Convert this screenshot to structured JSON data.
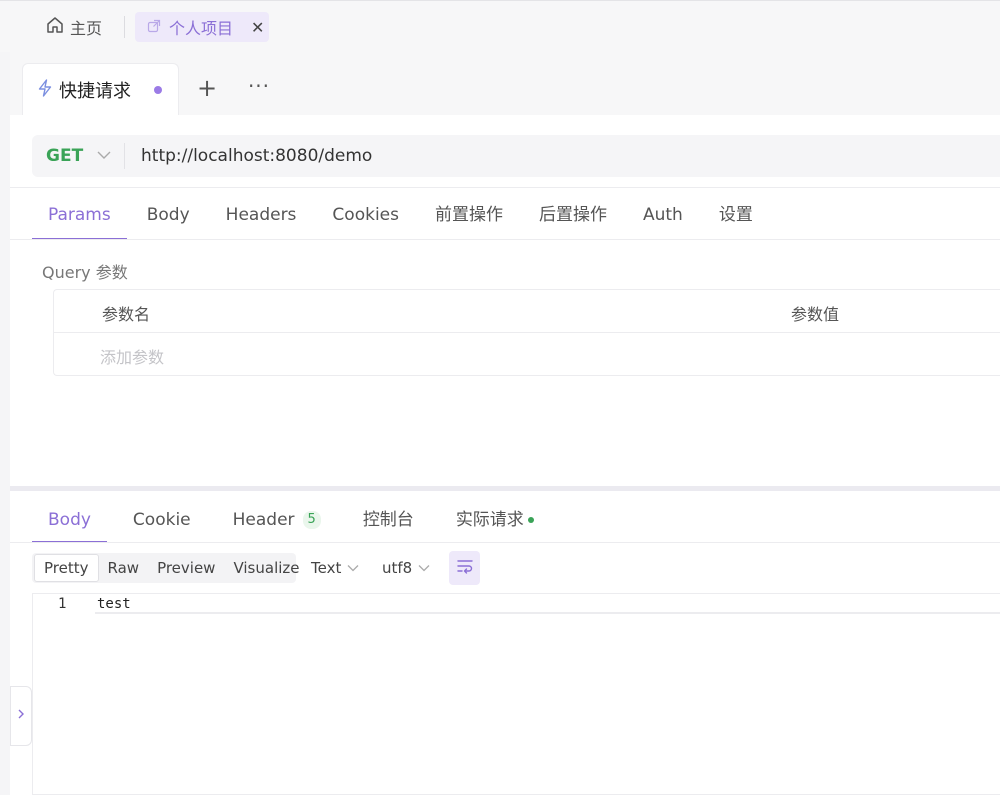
{
  "top_tabs": {
    "home_label": "主页",
    "project_label": "个人项目",
    "project_close": "✕"
  },
  "request_tab": {
    "label": "快捷请求",
    "add_label": "+",
    "more_label": "···"
  },
  "request": {
    "method": "GET",
    "url": "http://localhost:8080/demo"
  },
  "request_tabs": [
    {
      "label": "Params",
      "active": true
    },
    {
      "label": "Body"
    },
    {
      "label": "Headers"
    },
    {
      "label": "Cookies"
    },
    {
      "label": "前置操作"
    },
    {
      "label": "后置操作"
    },
    {
      "label": "Auth"
    },
    {
      "label": "设置"
    }
  ],
  "params": {
    "section_label": "Query 参数",
    "col_name": "参数名",
    "col_value": "参数值",
    "add_placeholder": "添加参数"
  },
  "response_tabs": {
    "body": "Body",
    "cookie": "Cookie",
    "header": "Header",
    "header_count": "5",
    "console": "控制台",
    "actual_request": "实际请求"
  },
  "view_modes": [
    "Pretty",
    "Raw",
    "Preview",
    "Visualize"
  ],
  "format": {
    "type": "Text",
    "encoding": "utf8"
  },
  "editor": {
    "line_number": "1",
    "content": "test"
  },
  "colors": {
    "accent": "#8b6fd6",
    "method_get": "#3aa357"
  }
}
